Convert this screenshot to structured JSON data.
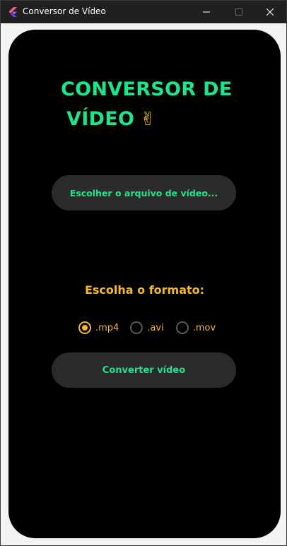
{
  "window": {
    "title": "Conversor de Vídeo"
  },
  "app": {
    "title_line1": "CONVERSOR DE",
    "title_line2": "VÍDEO",
    "title_emoji": "✌",
    "pick_file_label": "Escolher o arquivo de vídeo...",
    "format_label": "Escolha o formato:",
    "formats": [
      {
        "label": ".mp4",
        "checked": true
      },
      {
        "label": ".avi",
        "checked": false
      },
      {
        "label": ".mov",
        "checked": false
      }
    ],
    "convert_label": "Converter vídeo"
  },
  "colors": {
    "accent_green": "#1de58a",
    "accent_yellow": "#f3b82b",
    "button_bg": "#2b2b2b",
    "phone_bg": "#000000",
    "titlebar_bg": "#202020"
  },
  "icons": {
    "app": "flutter-logo-icon",
    "minimize": "minimize-icon",
    "maximize": "maximize-icon",
    "close": "close-icon",
    "emoji": "victory-hand-emoji"
  }
}
